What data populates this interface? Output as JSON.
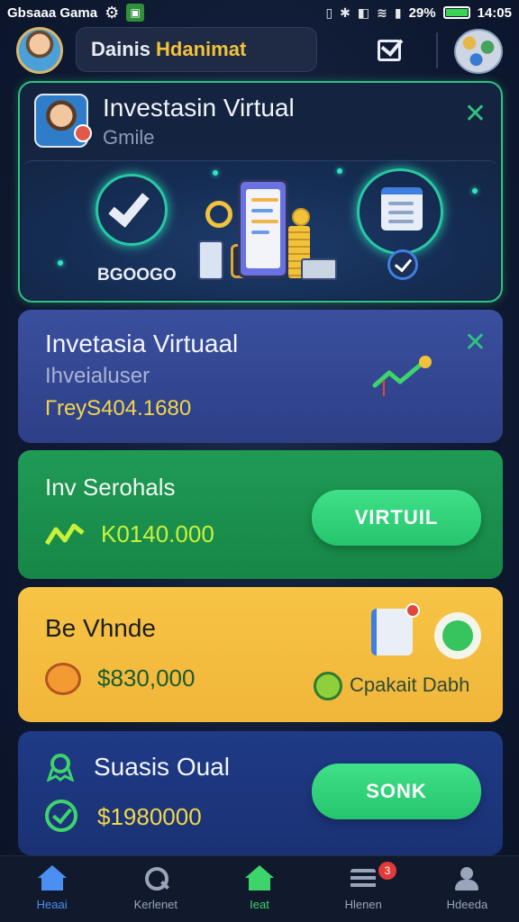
{
  "status_bar": {
    "app_name": "Gbsaaa Gama",
    "battery": "29%",
    "time": "14:05"
  },
  "header": {
    "title_part1": "Dainis",
    "title_part2": "Hdanimat"
  },
  "hero_card": {
    "title": "Investasin Virtual",
    "subtitle": "Gmile",
    "amount": "BGOOGO"
  },
  "card_blue": {
    "title": "Invetasia Virtuaal",
    "subtitle": "Ihveialuser",
    "amount": "ГrеуS404.1680"
  },
  "card_green": {
    "title": "Inv Serohals",
    "amount": "K0140.000",
    "button": "VIRTUIL"
  },
  "card_yellow": {
    "title": "Be  Vhnde",
    "amount": "$830,000",
    "link": "Cpakait Dabh"
  },
  "card_navy": {
    "title": "Suasis Oual",
    "amount": "$1980000",
    "button": "SONK"
  },
  "bottom_nav": {
    "items": [
      {
        "label": "Heaai",
        "icon": "home-icon"
      },
      {
        "label": "Kerlenet",
        "icon": "search-icon"
      },
      {
        "label": "Ieat",
        "icon": "home-icon"
      },
      {
        "label": "Hlenen",
        "icon": "list-icon",
        "badge": "3"
      },
      {
        "label": "Hdeeda",
        "icon": "user-icon"
      }
    ]
  },
  "colors": {
    "accent_green": "#2ec27e",
    "accent_blue": "#4c8ff2",
    "accent_yellow": "#f2d64a"
  }
}
